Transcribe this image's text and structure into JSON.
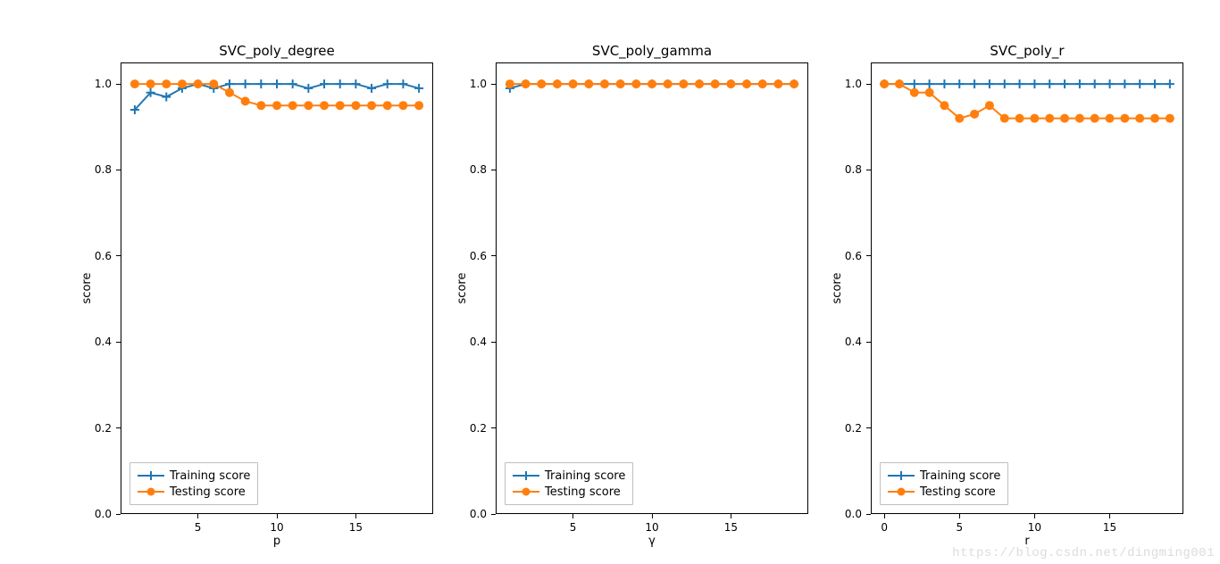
{
  "figure": {
    "watermark": "https://blog.csdn.net/dingming001",
    "colors": {
      "train": "#1f77b4",
      "test": "#ff7f0e"
    },
    "y_ticks": [
      "0.0",
      "0.2",
      "0.4",
      "0.6",
      "0.8",
      "1.0"
    ],
    "legend": {
      "train": "Training score",
      "test": "Testing score"
    }
  },
  "chart_data": [
    {
      "title": "SVC_poly_degree",
      "type": "line",
      "xlabel": "p",
      "ylabel": "score",
      "ylim": [
        0,
        1.05
      ],
      "xlim": [
        0.1,
        19.9
      ],
      "x_ticks": [
        5,
        10,
        15
      ],
      "series": [
        {
          "name": "Training score",
          "marker": "plus",
          "x": [
            1,
            2,
            3,
            4,
            5,
            6,
            7,
            8,
            9,
            10,
            11,
            12,
            13,
            14,
            15,
            16,
            17,
            18,
            19
          ],
          "y": [
            0.94,
            0.98,
            0.97,
            0.99,
            1.0,
            0.99,
            1.0,
            1.0,
            1.0,
            1.0,
            1.0,
            0.99,
            1.0,
            1.0,
            1.0,
            0.99,
            1.0,
            1.0,
            0.99
          ]
        },
        {
          "name": "Testing score",
          "marker": "dot",
          "x": [
            1,
            2,
            3,
            4,
            5,
            6,
            7,
            8,
            9,
            10,
            11,
            12,
            13,
            14,
            15,
            16,
            17,
            18,
            19
          ],
          "y": [
            1.0,
            1.0,
            1.0,
            1.0,
            1.0,
            1.0,
            0.98,
            0.96,
            0.95,
            0.95,
            0.95,
            0.95,
            0.95,
            0.95,
            0.95,
            0.95,
            0.95,
            0.95,
            0.95
          ]
        }
      ]
    },
    {
      "title": "SVC_poly_gamma",
      "type": "line",
      "xlabel": "γ",
      "ylabel": "score",
      "ylim": [
        0,
        1.05
      ],
      "xlim": [
        0.1,
        19.9
      ],
      "x_ticks": [
        5,
        10,
        15
      ],
      "series": [
        {
          "name": "Training score",
          "marker": "plus",
          "x": [
            1,
            2,
            3,
            4,
            5,
            6,
            7,
            8,
            9,
            10,
            11,
            12,
            13,
            14,
            15,
            16,
            17,
            18,
            19
          ],
          "y": [
            0.99,
            1.0,
            1.0,
            1.0,
            1.0,
            1.0,
            1.0,
            1.0,
            1.0,
            1.0,
            1.0,
            1.0,
            1.0,
            1.0,
            1.0,
            1.0,
            1.0,
            1.0,
            1.0
          ]
        },
        {
          "name": "Testing score",
          "marker": "dot",
          "x": [
            1,
            2,
            3,
            4,
            5,
            6,
            7,
            8,
            9,
            10,
            11,
            12,
            13,
            14,
            15,
            16,
            17,
            18,
            19
          ],
          "y": [
            1.0,
            1.0,
            1.0,
            1.0,
            1.0,
            1.0,
            1.0,
            1.0,
            1.0,
            1.0,
            1.0,
            1.0,
            1.0,
            1.0,
            1.0,
            1.0,
            1.0,
            1.0,
            1.0
          ]
        }
      ]
    },
    {
      "title": "SVC_poly_r",
      "type": "line",
      "xlabel": "r",
      "ylabel": "score",
      "ylim": [
        0,
        1.05
      ],
      "xlim": [
        -0.9,
        19.9
      ],
      "x_ticks": [
        0,
        5,
        10,
        15
      ],
      "series": [
        {
          "name": "Training score",
          "marker": "plus",
          "x": [
            0,
            1,
            2,
            3,
            4,
            5,
            6,
            7,
            8,
            9,
            10,
            11,
            12,
            13,
            14,
            15,
            16,
            17,
            18,
            19
          ],
          "y": [
            1.0,
            1.0,
            1.0,
            1.0,
            1.0,
            1.0,
            1.0,
            1.0,
            1.0,
            1.0,
            1.0,
            1.0,
            1.0,
            1.0,
            1.0,
            1.0,
            1.0,
            1.0,
            1.0,
            1.0
          ]
        },
        {
          "name": "Testing score",
          "marker": "dot",
          "x": [
            0,
            1,
            2,
            3,
            4,
            5,
            6,
            7,
            8,
            9,
            10,
            11,
            12,
            13,
            14,
            15,
            16,
            17,
            18,
            19
          ],
          "y": [
            1.0,
            1.0,
            0.98,
            0.98,
            0.95,
            0.92,
            0.93,
            0.95,
            0.92,
            0.92,
            0.92,
            0.92,
            0.92,
            0.92,
            0.92,
            0.92,
            0.92,
            0.92,
            0.92,
            0.92
          ]
        }
      ]
    }
  ]
}
